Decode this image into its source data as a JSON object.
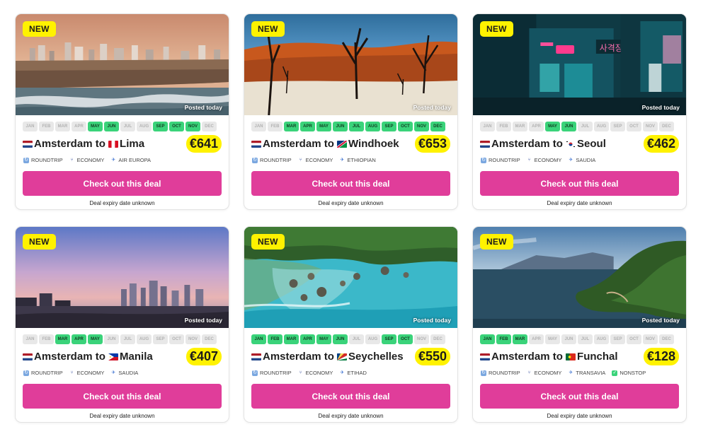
{
  "months": [
    "JAN",
    "FEB",
    "MAR",
    "APR",
    "MAY",
    "JUN",
    "JUL",
    "AUG",
    "SEP",
    "OCT",
    "NOV",
    "DEC"
  ],
  "colors": {
    "cta": "#e03d9a",
    "badge": "#fff200",
    "month_on": "#3ad37a",
    "month_off": "#e8e8e8"
  },
  "deals": [
    {
      "badge": "NEW",
      "posted": "Posted today",
      "route_prefix": "Amsterdam to ",
      "city": "Lima",
      "origin_flag": "flag-netherlands-icon",
      "dest_flag": "flag-peru-icon",
      "price": "€641",
      "active_months": [
        0,
        0,
        0,
        0,
        1,
        1,
        0,
        0,
        1,
        1,
        1,
        0
      ],
      "tags": [
        {
          "icon": "roundtrip-icon",
          "label": "ROUNDTRIP"
        },
        {
          "icon": "seat-icon",
          "label": "ECONOMY"
        },
        {
          "icon": "plane-icon",
          "label": "AIR EUROPA"
        }
      ],
      "cta": "Check out this deal",
      "expiry": "Deal expiry date unknown"
    },
    {
      "badge": "NEW",
      "posted": "Posted today",
      "route_prefix": "Amsterdam to ",
      "city": "Windhoek",
      "origin_flag": "flag-netherlands-icon",
      "dest_flag": "flag-namibia-icon",
      "price": "€653",
      "active_months": [
        0,
        0,
        1,
        1,
        1,
        1,
        1,
        1,
        1,
        1,
        1,
        1
      ],
      "tags": [
        {
          "icon": "roundtrip-icon",
          "label": "ROUNDTRIP"
        },
        {
          "icon": "seat-icon",
          "label": "ECONOMY"
        },
        {
          "icon": "plane-icon",
          "label": "ETHIOPIAN"
        }
      ],
      "cta": "Check out this deal",
      "expiry": "Deal expiry date unknown"
    },
    {
      "badge": "NEW",
      "posted": "Posted today",
      "route_prefix": "Amsterdam to ",
      "city": "Seoul",
      "origin_flag": "flag-netherlands-icon",
      "dest_flag": "flag-south-korea-icon",
      "price": "€462",
      "active_months": [
        0,
        0,
        0,
        0,
        1,
        1,
        0,
        0,
        0,
        0,
        0,
        0
      ],
      "tags": [
        {
          "icon": "roundtrip-icon",
          "label": "ROUNDTRIP"
        },
        {
          "icon": "seat-icon",
          "label": "ECONOMY"
        },
        {
          "icon": "plane-icon",
          "label": "SAUDIA"
        }
      ],
      "cta": "Check out this deal",
      "expiry": "Deal expiry date unknown"
    },
    {
      "badge": "NEW",
      "posted": "Posted today",
      "route_prefix": "Amsterdam to ",
      "city": "Manila",
      "origin_flag": "flag-netherlands-icon",
      "dest_flag": "flag-philippines-icon",
      "price": "€407",
      "active_months": [
        0,
        0,
        1,
        1,
        1,
        0,
        0,
        0,
        0,
        0,
        0,
        0
      ],
      "tags": [
        {
          "icon": "roundtrip-icon",
          "label": "ROUNDTRIP"
        },
        {
          "icon": "seat-icon",
          "label": "ECONOMY"
        },
        {
          "icon": "plane-icon",
          "label": "SAUDIA"
        }
      ],
      "cta": "Check out this deal",
      "expiry": "Deal expiry date unknown"
    },
    {
      "badge": "NEW",
      "posted": "Posted today",
      "route_prefix": "Amsterdam to ",
      "city": "Seychelles",
      "origin_flag": "flag-netherlands-icon",
      "dest_flag": "flag-seychelles-icon",
      "price": "€550",
      "active_months": [
        1,
        1,
        1,
        1,
        1,
        1,
        0,
        0,
        1,
        1,
        0,
        0
      ],
      "tags": [
        {
          "icon": "roundtrip-icon",
          "label": "ROUNDTRIP"
        },
        {
          "icon": "seat-icon",
          "label": "ECONOMY"
        },
        {
          "icon": "plane-icon",
          "label": "ETIHAD"
        }
      ],
      "cta": "Check out this deal",
      "expiry": "Deal expiry date unknown"
    },
    {
      "badge": "NEW",
      "posted": "Posted today",
      "route_prefix": "Amsterdam to ",
      "city": "Funchal",
      "origin_flag": "flag-netherlands-icon",
      "dest_flag": "flag-portugal-icon",
      "price": "€128",
      "active_months": [
        1,
        1,
        1,
        0,
        0,
        0,
        0,
        0,
        0,
        0,
        0,
        0
      ],
      "tags": [
        {
          "icon": "roundtrip-icon",
          "label": "ROUNDTRIP"
        },
        {
          "icon": "seat-icon",
          "label": "ECONOMY"
        },
        {
          "icon": "plane-icon",
          "label": "TRANSAVIA"
        },
        {
          "icon": "check-icon",
          "label": "NONSTOP"
        }
      ],
      "cta": "Check out this deal",
      "expiry": "Deal expiry date unknown"
    }
  ]
}
